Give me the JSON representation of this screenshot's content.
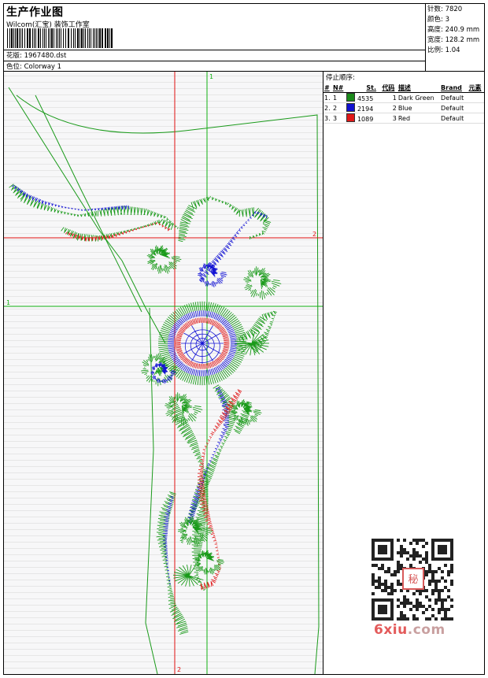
{
  "header": {
    "title": "生产作业图",
    "studio": "Wilcom(汇宝) 装饰工作室",
    "design_line": "花版:  1967480.dst",
    "colorway_line": "色位:  Colorway 1"
  },
  "stats": [
    {
      "label": "针数:",
      "value": "7820"
    },
    {
      "label": "颜色:",
      "value": "3"
    },
    {
      "label": "高度:",
      "value": "240.9 mm"
    },
    {
      "label": "宽度:",
      "value": "128.2 mm"
    },
    {
      "label": "比例:",
      "value": "1.04"
    }
  ],
  "stop_sequence": {
    "title": "停止顺序:",
    "columns": [
      "#",
      "N#",
      "St.",
      "代码",
      "描述",
      "Brand",
      "元素"
    ],
    "rows": [
      {
        "num": "1.",
        "n": "1",
        "color": "#1a8a1a",
        "stitches": "4535",
        "code": "1",
        "desc": "Dark Green",
        "brand": "Default"
      },
      {
        "num": "2.",
        "n": "2",
        "color": "#1010d0",
        "stitches": "2194",
        "code": "2",
        "desc": "Blue",
        "brand": "Default"
      },
      {
        "num": "3.",
        "n": "3",
        "color": "#e01818",
        "stitches": "1089",
        "code": "3",
        "desc": "Red",
        "brand": "Default"
      }
    ]
  },
  "guides": {
    "v1_label": "1",
    "v2_label": "2",
    "h1_label": "1",
    "h2_label": "2"
  },
  "colors": {
    "green": "#1a9a1a",
    "blue": "#1414d4",
    "red": "#e01818",
    "guide_red": "#e01010",
    "guide_green": "#12b012"
  },
  "watermark": {
    "text": "6xiu",
    "suffix": ".com",
    "seal_text": "秘",
    "qr_icon": "qr-code-icon"
  }
}
